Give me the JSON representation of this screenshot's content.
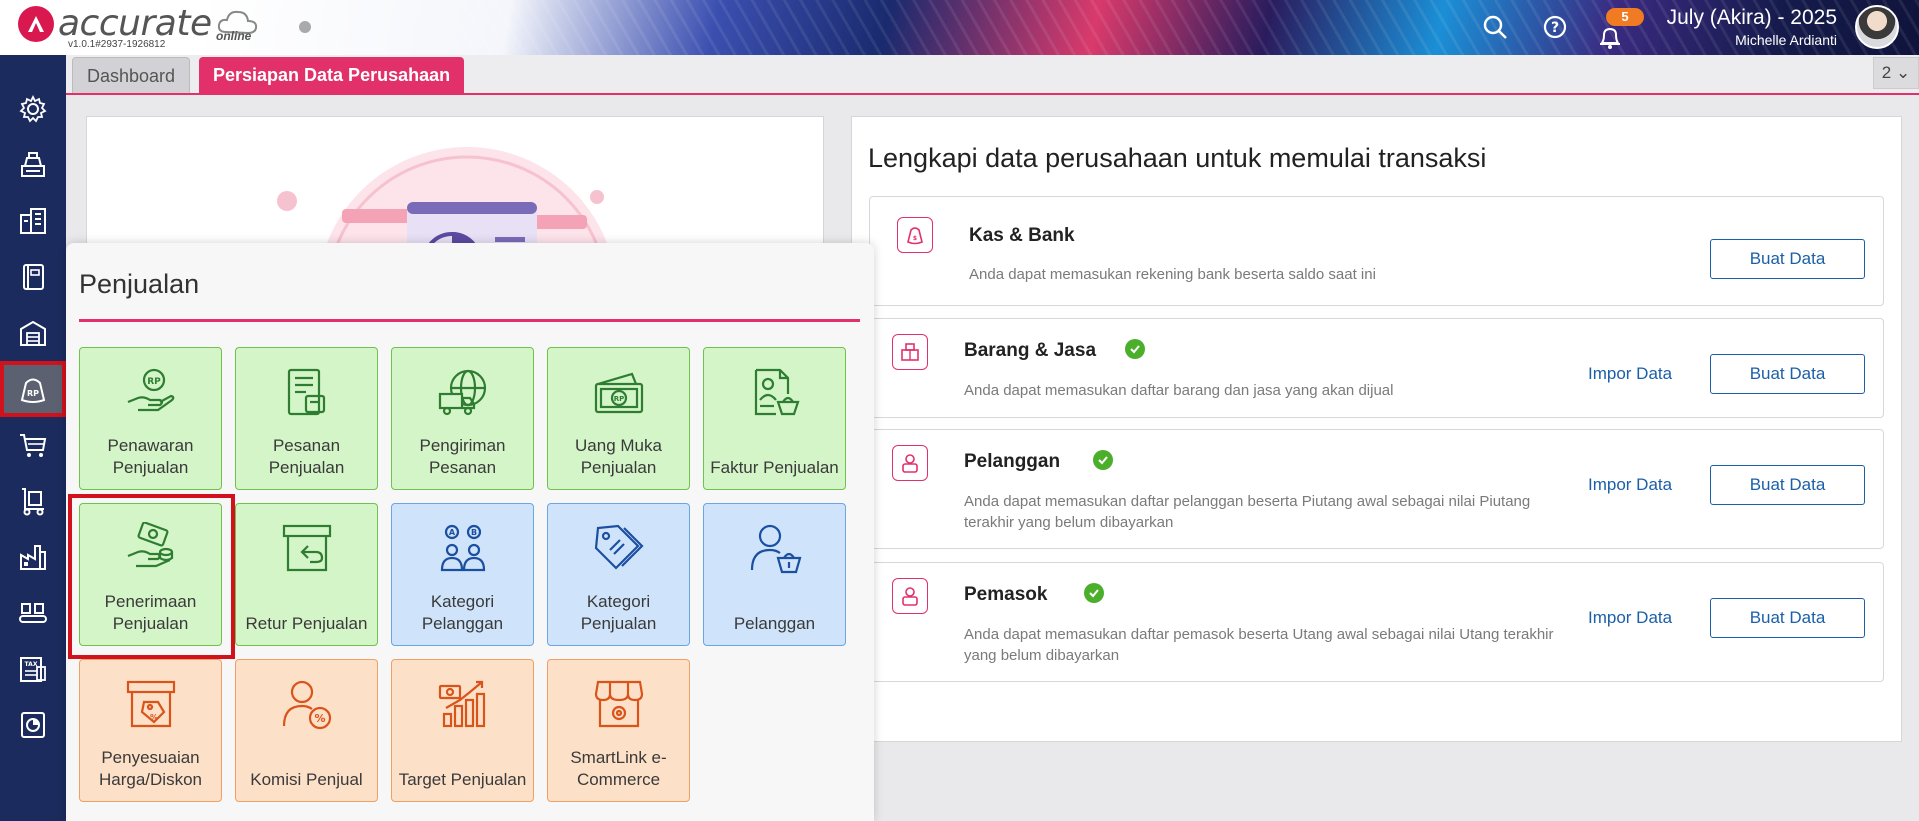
{
  "app": {
    "logo_text": "accurate",
    "logo_sub": "online",
    "version": "v1.0.1#2937-1926812",
    "database_name": "July (Akira) - 2025",
    "user_name": "Michelle Ardianti",
    "notification_count": "5"
  },
  "sidebar": {
    "items": [
      {
        "icon": "gear-icon"
      },
      {
        "icon": "cash-register-icon"
      },
      {
        "icon": "building-icon"
      },
      {
        "icon": "ledger-book-icon"
      },
      {
        "icon": "warehouse-icon"
      },
      {
        "icon": "sales-bag-icon",
        "active": true
      },
      {
        "icon": "shopping-cart-icon"
      },
      {
        "icon": "hand-truck-icon"
      },
      {
        "icon": "factory-icon"
      },
      {
        "icon": "conveyor-icon"
      },
      {
        "icon": "tax-icon"
      },
      {
        "icon": "report-chart-icon"
      }
    ]
  },
  "tabs": {
    "dashboard": "Dashboard",
    "active": "Persiapan Data Perusahaan",
    "counter": "2"
  },
  "setup": {
    "title": "Lengkapi data perusahaan untuk memulai transaksi",
    "cards": [
      {
        "title": "Kas & Bank",
        "desc": "Anda dapat memasukan rekening bank beserta saldo saat ini",
        "done": false,
        "import": "",
        "create": "Buat Data"
      },
      {
        "title": "Barang & Jasa",
        "desc": "Anda dapat memasukan daftar barang dan jasa yang akan dijual",
        "done": true,
        "import": "Impor Data",
        "create": "Buat Data"
      },
      {
        "title": "Pelanggan",
        "desc": "Anda dapat memasukan daftar pelanggan beserta Piutang awal sebagai nilai Piutang terakhir yang belum dibayarkan",
        "done": true,
        "import": "Impor Data",
        "create": "Buat Data"
      },
      {
        "title": "Pemasok",
        "desc": "Anda dapat memasukan daftar pemasok beserta Utang awal sebagai nilai Utang terakhir yang belum dibayarkan",
        "done": true,
        "import": "Impor Data",
        "create": "Buat Data"
      }
    ]
  },
  "menu": {
    "title": "Penjualan",
    "tiles": [
      {
        "label": "Penawaran Penjualan",
        "icon": "rp-offer-hand-icon",
        "color": "green"
      },
      {
        "label": "Pesanan Penjualan",
        "icon": "order-document-icon",
        "color": "green"
      },
      {
        "label": "Pengiriman Pesanan",
        "icon": "delivery-globe-truck-icon",
        "color": "green"
      },
      {
        "label": "Uang Muka Penjualan",
        "icon": "money-stack-icon",
        "color": "green"
      },
      {
        "label": "Faktur Penjualan",
        "icon": "invoice-icon",
        "color": "green"
      },
      {
        "label": "Penerimaan Penjualan",
        "icon": "cash-receive-hand-icon",
        "color": "green",
        "highlighted": true
      },
      {
        "label": "Retur Penjualan",
        "icon": "return-box-icon",
        "color": "green"
      },
      {
        "label": "Kategori Pelanggan",
        "icon": "customer-category-icon",
        "color": "blue"
      },
      {
        "label": "Kategori Penjualan",
        "icon": "tag-category-icon",
        "color": "blue"
      },
      {
        "label": "Pelanggan",
        "icon": "customer-basket-icon",
        "color": "blue"
      },
      {
        "label": "Penyesuaian Harga/Diskon",
        "icon": "price-adjust-icon",
        "color": "orange"
      },
      {
        "label": "Komisi Penjual",
        "icon": "commission-icon",
        "color": "orange"
      },
      {
        "label": "Target Penjualan",
        "icon": "sales-target-icon",
        "color": "orange"
      },
      {
        "label": "SmartLink e-Commerce",
        "icon": "smartlink-store-icon",
        "color": "orange"
      }
    ]
  },
  "colors": {
    "brand": "#e2316a",
    "sidebar": "#1c2b5e",
    "link": "#1b5fa8",
    "success": "#4caf2c",
    "highlight": "#d1111b"
  }
}
